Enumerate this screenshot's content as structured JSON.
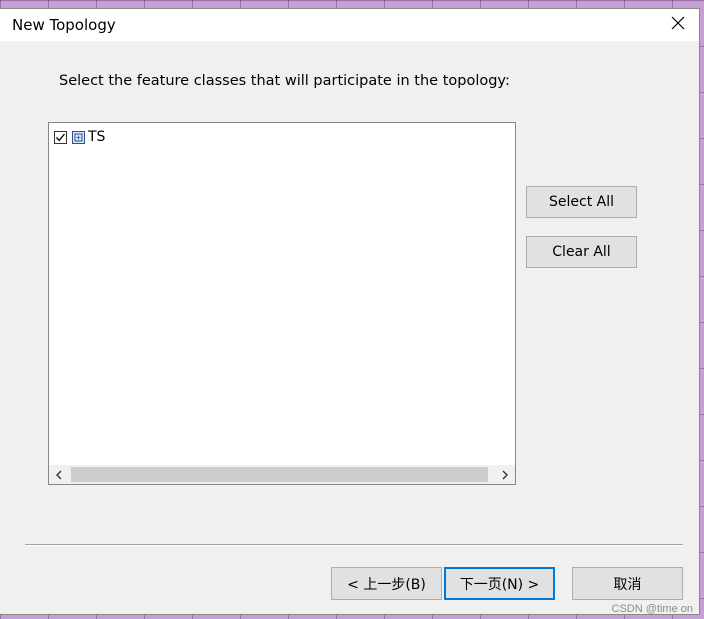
{
  "window": {
    "title": "New Topology",
    "close_icon": "close-icon"
  },
  "instruction": "Select the feature classes that will participate in the topology:",
  "feature_list": {
    "items": [
      {
        "label": "TS",
        "checked": true,
        "icon": "feature-class-icon"
      }
    ]
  },
  "buttons": {
    "select_all": "Select All",
    "clear_all": "Clear All",
    "back": "< 上一步(B)",
    "next": "下一页(N) >",
    "cancel": "取消"
  },
  "watermark": "CSDN @time on"
}
